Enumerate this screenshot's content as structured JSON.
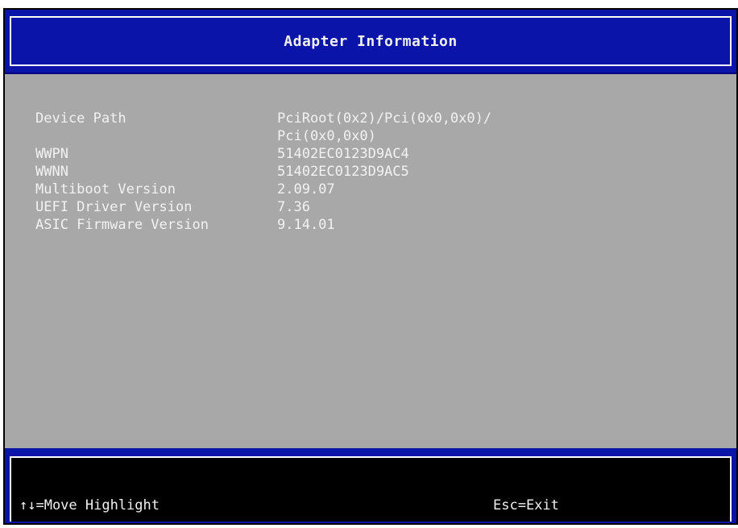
{
  "window": {
    "title": "Adapter Information"
  },
  "info": {
    "rows": [
      {
        "label": "Device Path",
        "value": "PciRoot(0x2)/Pci(0x0,0x0)/",
        "value_cont": "Pci(0x0,0x0)"
      },
      {
        "label": "WWPN",
        "value": "51402EC0123D9AC4"
      },
      {
        "label": "WWNN",
        "value": "51402EC0123D9AC5"
      },
      {
        "label": "Multiboot Version",
        "value": "2.09.07"
      },
      {
        "label": "UEFI Driver Version",
        "value": "7.36"
      },
      {
        "label": "ASIC Firmware Version",
        "value": "9.14.01"
      }
    ]
  },
  "footer": {
    "move_hint": "↑↓=Move Highlight",
    "exit_hint": "Esc=Exit"
  },
  "colors": {
    "title_bar": "#0a14a8",
    "content_background": "#a8a8a8",
    "text": "#f2f2f2",
    "footer_background": "#000000"
  }
}
